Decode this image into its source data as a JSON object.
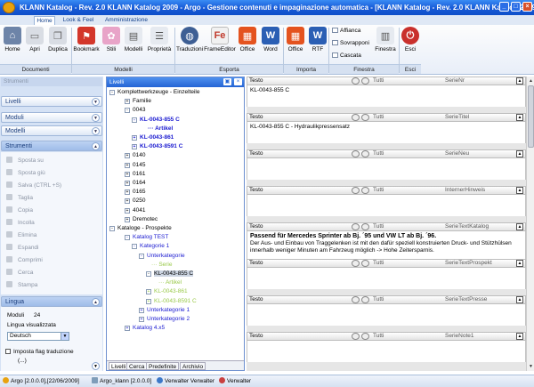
{
  "window": {
    "title": "KLANN Katalog - Rev. 2.0 KLANN Katalog 2009 - Argo - Gestione contenuti e impaginazione automatica - [KLANN Katalog - Rev. 2.0 KLANN Katalog 2009 ..."
  },
  "ribbon": {
    "tabs": [
      "Home",
      "Look & Feel",
      "Amministrazione"
    ],
    "buttons": {
      "home": "Home",
      "apri": "Apri",
      "duplica": "Duplica",
      "bookmark": "Bookmark",
      "stili": "Stili",
      "modelli": "Modelli",
      "proprieta": "Proprietà",
      "traduzioni": "Traduzioni",
      "frameeditor": "FrameEditor",
      "office": "Office",
      "word": "Word",
      "office2": "Office",
      "rtf": "RTF",
      "affianca": "Affianca",
      "sovrapponi": "Sovrapponi",
      "cascata": "Cascata",
      "finestra": "Finestra",
      "esci": "Esci"
    },
    "groups": {
      "documenti": "Documenti",
      "modelli": "Modelli",
      "esporta": "Esporta",
      "importa": "Importa",
      "finestra": "Finestra",
      "esci": "Esci"
    }
  },
  "left": {
    "header": "Strumenti",
    "sections": [
      "Livelli",
      "Moduli",
      "Modelli",
      "Strumenti"
    ],
    "strumenti_items": [
      "Sposta su",
      "Sposta giù",
      "Salva  (CTRL +S)",
      "Taglia",
      "Copia",
      "Incolla",
      "Elimina",
      "Espandi",
      "Comprimi",
      "Cerca",
      "Stampa"
    ],
    "lingua": {
      "title": "Lingua",
      "moduli_label": "Moduli",
      "moduli_value": "24",
      "visualizzata_label": "Lingua visualizzata",
      "selected": "Deutsch",
      "imposta_label": "Imposta flag traduzione",
      "extra": "(...)"
    }
  },
  "tree": {
    "header": "Livelli",
    "nodes": [
      {
        "text": "Komplettwerkzeuge - Einzelteile",
        "toggle": "-"
      },
      {
        "text": "Familie",
        "toggle": "+"
      },
      {
        "text": "0043",
        "toggle": "-"
      },
      {
        "text": "KL-0043-855 C",
        "toggle": "-"
      },
      {
        "text": "Artikel",
        "toggle": ""
      },
      {
        "text": "KL-0043-861",
        "toggle": "+"
      },
      {
        "text": "KL-0043-8591 C",
        "toggle": "+"
      },
      {
        "text": "0140",
        "toggle": "+"
      },
      {
        "text": "0145",
        "toggle": "+"
      },
      {
        "text": "0161",
        "toggle": "+"
      },
      {
        "text": "0164",
        "toggle": "+"
      },
      {
        "text": "0165",
        "toggle": "+"
      },
      {
        "text": "0250",
        "toggle": "+"
      },
      {
        "text": "4041",
        "toggle": "+"
      },
      {
        "text": "Dremotec",
        "toggle": "+"
      },
      {
        "text": "Kataloge - Prospekte",
        "toggle": "-"
      },
      {
        "text": "Katalog TEST",
        "toggle": "-"
      },
      {
        "text": "Kategorie 1",
        "toggle": "-"
      },
      {
        "text": "Unterkategorie",
        "toggle": "-"
      },
      {
        "text": "Serie",
        "toggle": ""
      },
      {
        "text": "KL-0043-855 C",
        "toggle": "-"
      },
      {
        "text": "Artikel",
        "toggle": ""
      },
      {
        "text": "KL-0043-861",
        "toggle": "+"
      },
      {
        "text": "KL-0043-8591 C",
        "toggle": "+"
      },
      {
        "text": "Unterkategorie 1",
        "toggle": "+"
      },
      {
        "text": "Unterkategorie 2",
        "toggle": "+"
      },
      {
        "text": "Katalog 4.x5",
        "toggle": "+"
      }
    ],
    "tabs": [
      "Livelli",
      "Cerca",
      "Predefinite",
      "Archivio"
    ]
  },
  "fields": [
    {
      "type": "Testo",
      "scope": "Tutti",
      "name": "SerieNr",
      "content": "KL-0043-855 C"
    },
    {
      "type": "Testo",
      "scope": "Tutti",
      "name": "SerieTitel",
      "content": "KL-0043-855 C - Hydraulikpressensatz"
    },
    {
      "type": "Testo",
      "scope": "Tutti",
      "name": "SerieNeu",
      "content": ""
    },
    {
      "type": "Testo",
      "scope": "Tutti",
      "name": "InternerHinweis",
      "content": ""
    },
    {
      "type": "Testo",
      "scope": "Tutti",
      "name": "SerieTextKatalog",
      "content_title": "Passend für Mercedes Sprinter ab Bj. ´95 und VW LT ab Bj. ´96.",
      "content": "Der Aus- und Einbau von Traggelenken ist mit den dafür speziell konstruierten Druck- und Stützhülsen innerhalb weniger Minuten am Fahrzeug möglich -> Hohe Zeitersparnis."
    },
    {
      "type": "Testo",
      "scope": "Tutti",
      "name": "SerieTextProspekt",
      "content": ""
    },
    {
      "type": "Testo",
      "scope": "Tutti",
      "name": "SerieTextPresse",
      "content": ""
    },
    {
      "type": "Testo",
      "scope": "Tutti",
      "name": "SerieNote1",
      "content": ""
    }
  ],
  "status": {
    "argo": "Argo [2.0.0.0],[22/06/2009]",
    "db": "Argo_klann [2.0.0.0]",
    "user": "Verwalter Verwalter",
    "role": "Verwalter"
  },
  "colors": {
    "titlebar": "#1659d6",
    "tree_blue": "#1a1ad0",
    "tree_green": "#9ac94b"
  }
}
